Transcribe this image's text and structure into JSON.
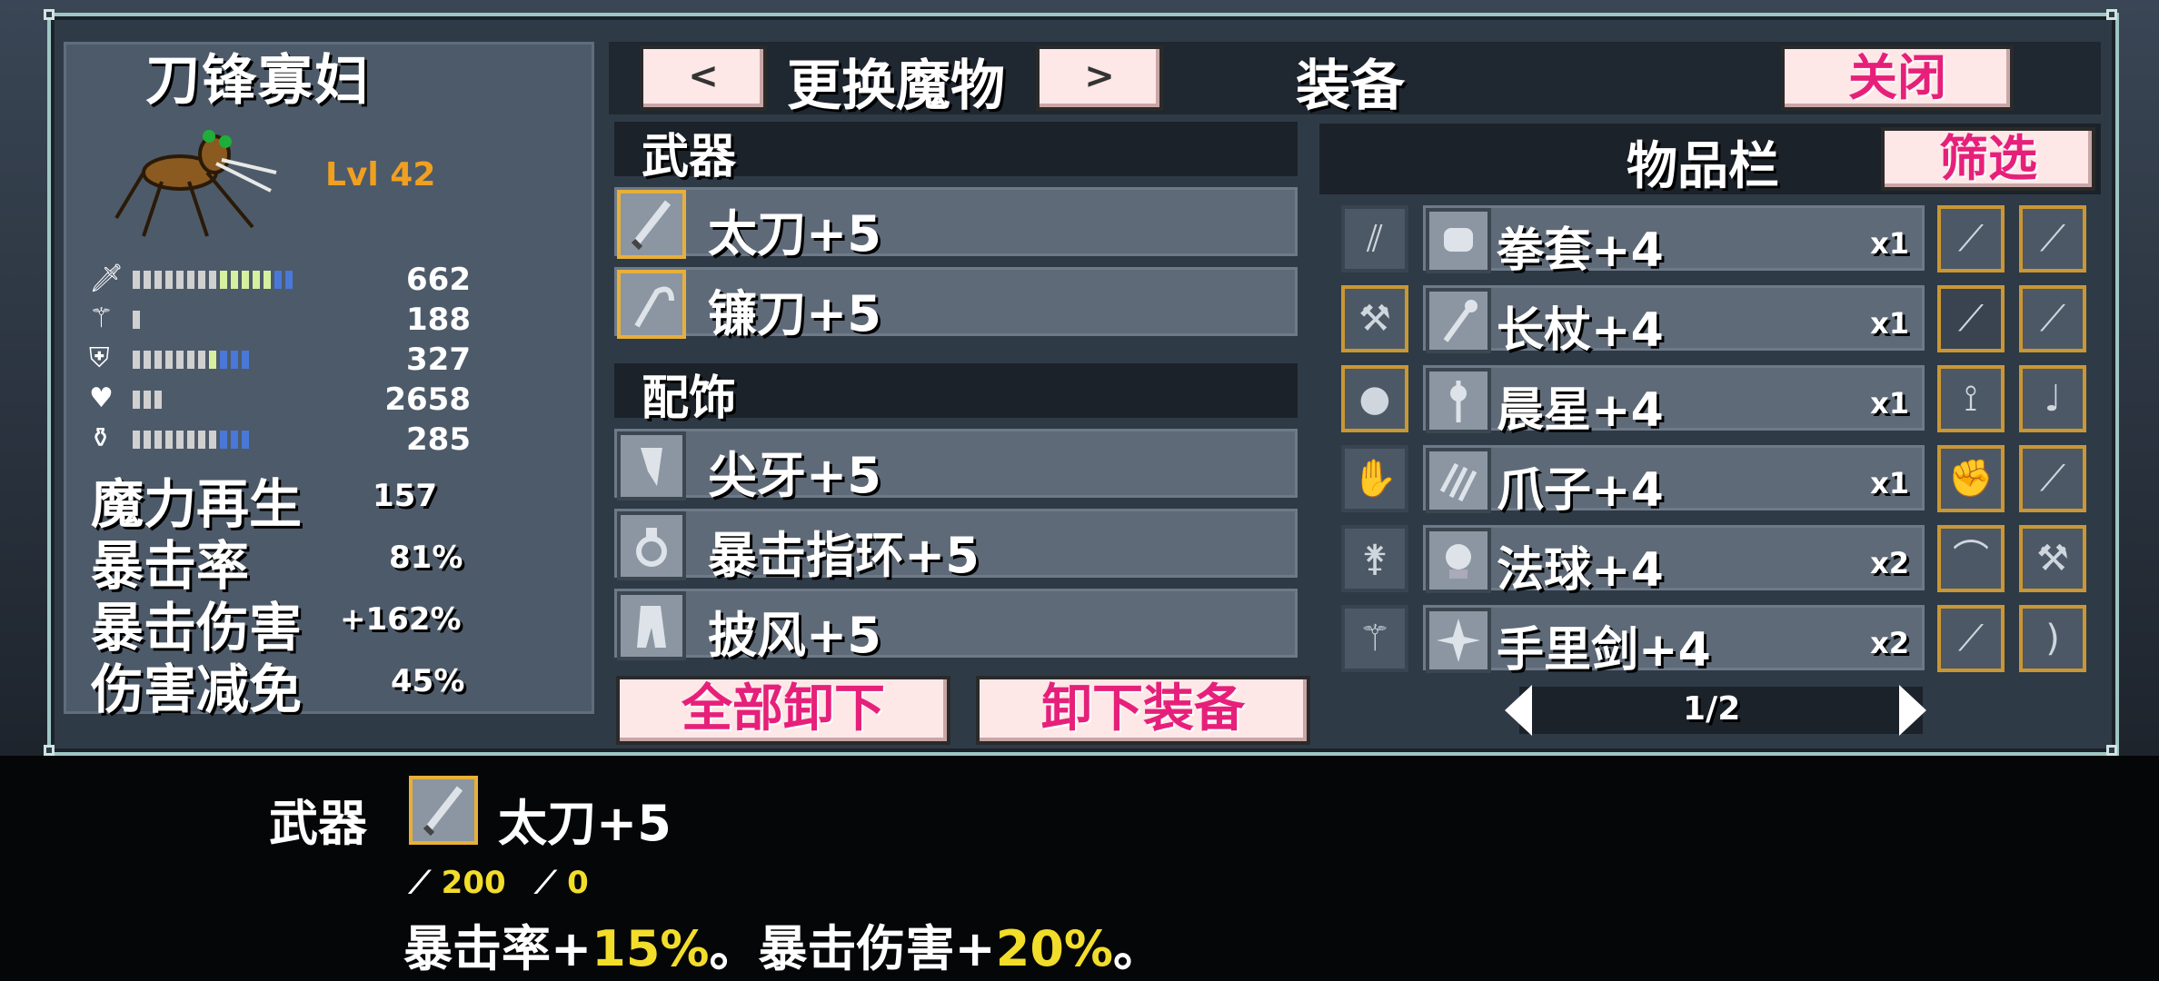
{
  "monster": {
    "name": "刀锋寡妇",
    "level": "Lvl 42",
    "stats": [
      {
        "icon": "sword-icon",
        "value": "662",
        "segments": [
          1,
          1,
          1,
          1,
          1,
          1,
          1,
          1,
          1,
          1,
          1,
          1,
          1,
          1,
          1,
          1,
          1
        ],
        "colors": "mixed"
      },
      {
        "icon": "wand-icon",
        "value": "188",
        "segments": [
          1
        ]
      },
      {
        "icon": "shield-icon",
        "value": "327",
        "segments": [
          1,
          1,
          1,
          1,
          1,
          1,
          1,
          1,
          1,
          1,
          1
        ]
      },
      {
        "icon": "heart-icon",
        "value": "2658",
        "segments": [
          1,
          1,
          1
        ]
      },
      {
        "icon": "potion-icon",
        "value": "285",
        "segments": [
          1,
          1,
          1,
          1,
          1,
          1,
          1,
          1,
          1,
          1,
          1
        ]
      }
    ],
    "attributes": [
      {
        "label": "魔力再生",
        "value": "157"
      },
      {
        "label": "暴击率",
        "value": "81%"
      },
      {
        "label": "暴击伤害",
        "value": "+162%"
      },
      {
        "label": "伤害减免",
        "value": "45%"
      }
    ]
  },
  "header": {
    "prev": "<",
    "change_monster": "更换魔物",
    "next": ">",
    "equipment": "装备",
    "close": "关闭"
  },
  "equipped": {
    "weapon_title": "武器",
    "weapons": [
      {
        "icon": "katana-icon",
        "label": "太刀+5",
        "selected": true
      },
      {
        "icon": "sickle-icon",
        "label": "镰刀+5",
        "selected": true
      }
    ],
    "accessory_title": "配饰",
    "accessories": [
      {
        "icon": "fang-icon",
        "label": "尖牙+5"
      },
      {
        "icon": "crit-ring-icon",
        "label": "暴击指环+5"
      },
      {
        "icon": "cape-icon",
        "label": "披风+5"
      }
    ],
    "unequip_all": "全部卸下",
    "unequip": "卸下装备"
  },
  "inventory": {
    "title": "物品栏",
    "filter": "筛选",
    "items": [
      {
        "left_icon": "claw-glyph-icon",
        "icon": "fist-icon",
        "label": "拳套+4",
        "qty": "x1",
        "slot1": "dagger-icon",
        "slot2": "sword-icon"
      },
      {
        "left_icon": "axe-icon",
        "icon": "staff-icon",
        "label": "长杖+4",
        "qty": "x1",
        "slot1": "blade-icon",
        "slot2": "spear-icon"
      },
      {
        "left_icon": "orb-icon",
        "icon": "morningstar-icon",
        "label": "晨星+4",
        "qty": "x1",
        "slot1": "scythe-icon",
        "slot2": "lute-icon"
      },
      {
        "left_icon": "glove-icon",
        "icon": "claw-icon",
        "label": "爪子+4",
        "qty": "x1",
        "slot1": "gauntlet-icon",
        "slot2": "rod-icon"
      },
      {
        "left_icon": "mace-icon",
        "icon": "magic-orb-icon",
        "label": "法球+4",
        "qty": "x2",
        "slot1": "horn-icon",
        "slot2": "hammer-icon"
      },
      {
        "left_icon": "wand-icon",
        "icon": "shuriken-icon",
        "label": "手里剑+4",
        "qty": "x2",
        "slot1": "knife-icon",
        "slot2": "bow-icon"
      }
    ],
    "page": "1/2"
  },
  "detail": {
    "category": "武器",
    "icon": "katana-icon",
    "name": "太刀+5",
    "atk": "200",
    "mag": "0",
    "desc_a": "暴击率+",
    "desc_b": "15%",
    "desc_c": "。暴击伤害+",
    "desc_d": "20%",
    "desc_e": "。"
  }
}
